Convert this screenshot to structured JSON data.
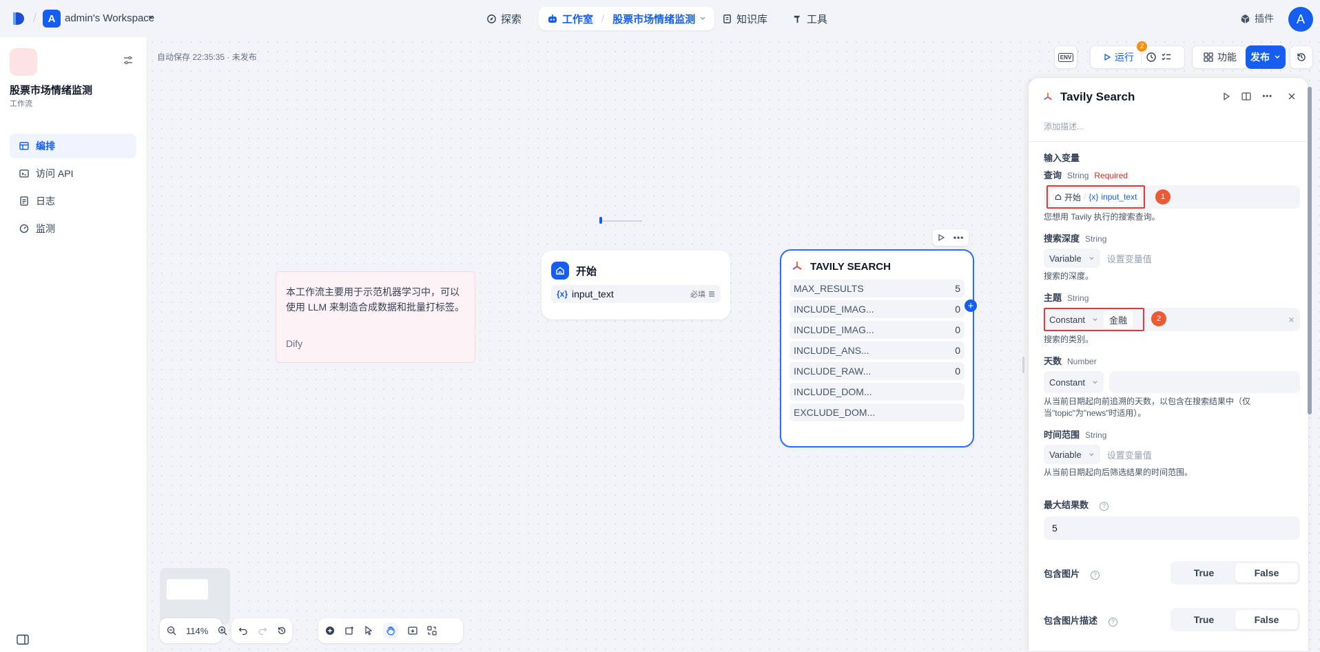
{
  "topnav": {
    "workspace_initial": "A",
    "workspace_name": "admin's Workspace",
    "explore": "探索",
    "studio": "工作室",
    "studio_app": "股票市场情绪监测",
    "knowledge": "知识库",
    "tools": "工具",
    "plugins": "插件",
    "user_initial": "A"
  },
  "sidebar": {
    "app_name": "股票市场情绪监测",
    "app_type": "工作流",
    "items": [
      {
        "label": "编排",
        "icon": "layout-icon",
        "active": true
      },
      {
        "label": "访问 API",
        "icon": "terminal-icon",
        "active": false
      },
      {
        "label": "日志",
        "icon": "file-list-icon",
        "active": false
      },
      {
        "label": "监测",
        "icon": "dashboard-icon",
        "active": false
      }
    ]
  },
  "canvas": {
    "autosave": "自动保存 22:35:35 · 未发布",
    "toolbar": {
      "env": "ENV",
      "run": "运行",
      "checklist_count": "2",
      "features": "功能",
      "publish": "发布"
    },
    "note": {
      "text": "本工作流主要用于示范机器学习中，可以使用 LLM 来制造合成数据和批量打标签。",
      "author": "Dify"
    },
    "start_node": {
      "title": "开始",
      "var": "input_text",
      "var_prefix": "{x}",
      "required": "必填"
    },
    "tavily_node": {
      "title": "TAVILY SEARCH",
      "rows": [
        {
          "name": "MAX_RESULTS",
          "value": "5"
        },
        {
          "name": "INCLUDE_IMAG...",
          "value": "0"
        },
        {
          "name": "INCLUDE_IMAG...",
          "value": "0"
        },
        {
          "name": "INCLUDE_ANS...",
          "value": "0"
        },
        {
          "name": "INCLUDE_RAW...",
          "value": "0"
        },
        {
          "name": "INCLUDE_DOM...",
          "value": ""
        },
        {
          "name": "EXCLUDE_DOM...",
          "value": ""
        }
      ]
    },
    "zoom": "114%"
  },
  "panel": {
    "title": "Tavily Search",
    "description_placeholder": "添加描述...",
    "section_input": "输入变量",
    "query": {
      "label": "查询",
      "type": "String",
      "required": "Required",
      "chip_node": "开始",
      "chip_sep": "/",
      "chip_var_prefix": "{x}",
      "chip_var": "input_text",
      "annotation": "1",
      "hint": "您想用 Tavily 执行的搜索查询。"
    },
    "search_depth": {
      "label": "搜索深度",
      "type": "String",
      "mode": "Variable",
      "placeholder": "设置变量值",
      "hint": "搜索的深度。"
    },
    "topic": {
      "label": "主题",
      "type": "String",
      "mode": "Constant",
      "value": "金融",
      "annotation": "2",
      "hint": "搜索的类别。"
    },
    "days": {
      "label": "天数",
      "type": "Number",
      "mode": "Constant",
      "hint": "从当前日期起向前追溯的天数，以包含在搜索结果中（仅当\"topic\"为\"news\"时适用）。"
    },
    "time_range": {
      "label": "时间范围",
      "type": "String",
      "mode": "Variable",
      "placeholder": "设置变量值",
      "hint": "从当前日期起向后筛选结果的时间范围。"
    },
    "max_results": {
      "label": "最大结果数",
      "value": "5"
    },
    "include_images": {
      "label": "包含图片",
      "true_label": "True",
      "false_label": "False",
      "selected": "False"
    },
    "include_image_desc": {
      "label": "包含图片描述",
      "true_label": "True",
      "false_label": "False",
      "selected": "False"
    }
  },
  "colors": {
    "primary": "#155eef",
    "annotation_red": "#e5393b",
    "annotation_badge": "#ea5b35",
    "required_red": "#d92d20",
    "note_bg": "#fdf2f6"
  }
}
